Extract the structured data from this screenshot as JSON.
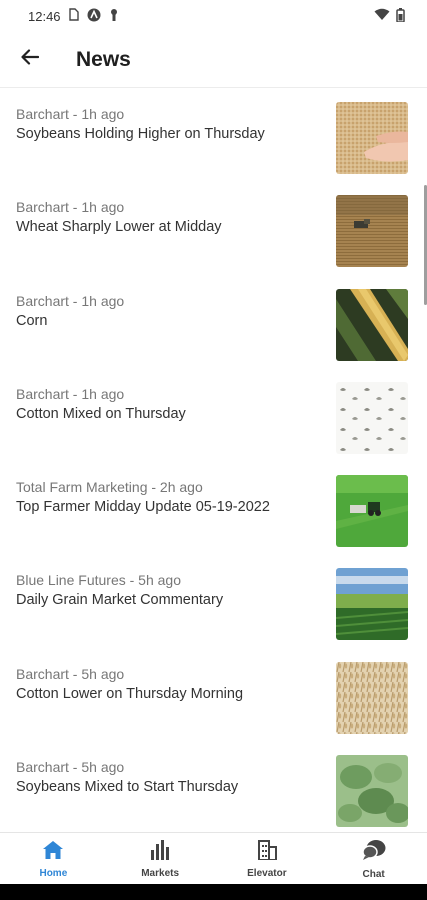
{
  "status_bar": {
    "time": "12:46",
    "icons": [
      "sim-icon",
      "vpn-icon",
      "lock-icon",
      "wifi-icon",
      "battery-icon"
    ]
  },
  "header": {
    "back_icon": "arrow-left-icon",
    "title": "News"
  },
  "news": [
    {
      "source": "Barchart - 1h ago",
      "title": "Soybeans Holding Higher on Thursday",
      "thumb": "soybean-hands"
    },
    {
      "source": "Barchart - 1h ago",
      "title": "Wheat Sharply Lower at Midday",
      "thumb": "wheat-harvest"
    },
    {
      "source": "Barchart - 1h ago",
      "title": "Corn",
      "thumb": "corn-cob"
    },
    {
      "source": "Barchart - 1h ago",
      "title": "Cotton Mixed on Thursday",
      "thumb": "cotton-pattern"
    },
    {
      "source": "Total Farm Marketing - 2h ago",
      "title": "Top Farmer Midday Update 05-19-2022",
      "thumb": "tractor-field"
    },
    {
      "source": "Blue Line Futures - 5h ago",
      "title": "Daily Grain Market Commentary",
      "thumb": "crop-rows"
    },
    {
      "source": "Barchart - 5h ago",
      "title": "Cotton Lower on Thursday Morning",
      "thumb": "wheat-stalks"
    },
    {
      "source": "Barchart - 5h ago",
      "title": "Soybeans Mixed to Start Thursday",
      "thumb": "soybean-leaves"
    }
  ],
  "bottom_nav": [
    {
      "label": "Home",
      "icon": "home-icon",
      "active": true
    },
    {
      "label": "Markets",
      "icon": "bar-chart-icon",
      "active": false
    },
    {
      "label": "Elevator",
      "icon": "building-icon",
      "active": false
    },
    {
      "label": "Chat",
      "icon": "chat-icon",
      "active": false
    }
  ],
  "colors": {
    "accent": "#2f86d6",
    "text": "#333333",
    "meta": "#777777"
  }
}
